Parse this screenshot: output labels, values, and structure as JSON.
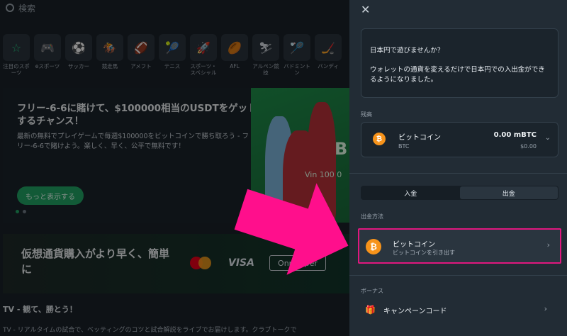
{
  "search": {
    "placeholder": "検索"
  },
  "sports": [
    {
      "icon": "star-icon",
      "glyph": "☆",
      "label": "注目のスポーツ",
      "active": true
    },
    {
      "icon": "gamepad-icon",
      "glyph": "🎮",
      "label": "eスポーツ"
    },
    {
      "icon": "soccer-icon",
      "glyph": "⚽",
      "label": "サッカー"
    },
    {
      "icon": "horse-racing-icon",
      "glyph": "🏇",
      "label": "競走馬"
    },
    {
      "icon": "american-football-icon",
      "glyph": "🏈",
      "label": "アメフト"
    },
    {
      "icon": "tennis-icon",
      "glyph": "🎾",
      "label": "テニス"
    },
    {
      "icon": "rocket-icon",
      "glyph": "🚀",
      "label": "スポーツ・スペシャル"
    },
    {
      "icon": "afl-icon",
      "glyph": "🏉",
      "label": "AFL"
    },
    {
      "icon": "skiing-icon",
      "glyph": "⛷",
      "label": "アルペン競技"
    },
    {
      "icon": "badminton-icon",
      "glyph": "🏸",
      "label": "バドミントン"
    },
    {
      "icon": "bandy-icon",
      "glyph": "🏒",
      "label": "バンディ"
    }
  ],
  "promo": {
    "title": "フリー-6-6に賭けて、$100000相当のUSDTをゲットするチャンス！",
    "text": "最新の無料でプレイゲームで毎週$100000をビットコインで勝ち取ろう - フリー-6-6で賭けよう。楽しく、早く、公平で無料です！",
    "button": "もっと表示する",
    "image_big": "B",
    "image_sub": "Vin 100 0"
  },
  "crypto_banner": {
    "title": "仮想通貨購入がより早く、簡単に",
    "visa": "VISA",
    "onramper": "Onramper"
  },
  "tv": {
    "title": "TV - 観て、勝とう！",
    "sub": "TV - リアルタイムの試合で、ベッティングのコツと試合解説をライブでお届けします。クラブトークで"
  },
  "panel": {
    "notice_line1": "日本円で遊びませんか？",
    "notice_line2": "ウォレットの通貨を変えるだけで日本円での入出金ができるようになりました。",
    "balance_label": "残高",
    "balance": {
      "coin": "₿",
      "name": "ビットコイン",
      "code": "BTC",
      "amount": "0.00 mBTC",
      "fiat": "$0.00"
    },
    "tabs": [
      "入金",
      "出金"
    ],
    "method_label": "出金方法",
    "method": {
      "coin": "₿",
      "name": "ビットコイン",
      "sub": "ビットコインを引き出す"
    },
    "bonus_label": "ボーナス",
    "campaign": "キャンペーンコード"
  },
  "colors": {
    "accent": "#22a565",
    "highlight": "#e0177f",
    "bitcoin": "#f7931a"
  }
}
